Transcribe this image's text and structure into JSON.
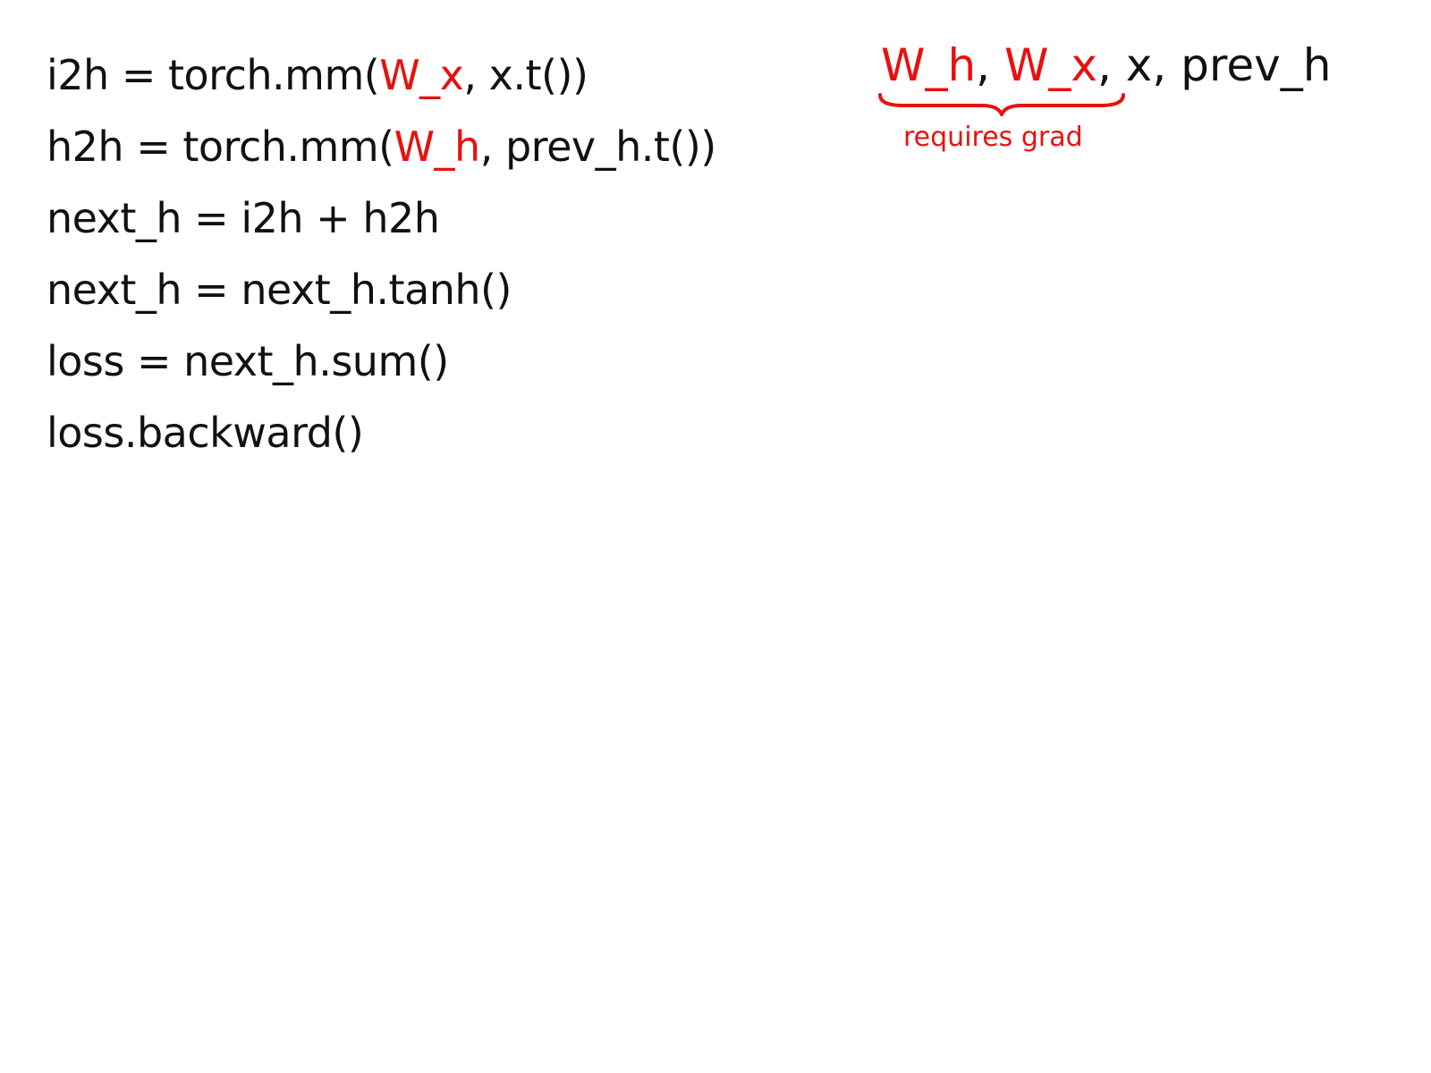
{
  "code_lines": [
    {
      "segments": [
        {
          "text": "i2h = torch.mm(",
          "color": "black"
        },
        {
          "text": "W_x",
          "color": "red"
        },
        {
          "text": ", x.t())",
          "color": "black"
        }
      ]
    },
    {
      "segments": [
        {
          "text": "h2h = torch.mm(",
          "color": "black"
        },
        {
          "text": "W_h",
          "color": "red"
        },
        {
          "text": ", prev_h.t())",
          "color": "black"
        }
      ]
    },
    {
      "segments": [
        {
          "text": "next_h = i2h + h2h",
          "color": "black"
        }
      ]
    },
    {
      "segments": [
        {
          "text": "next_h = next_h.tanh()",
          "color": "black"
        }
      ]
    },
    {
      "segments": [
        {
          "text": "loss = next_h.sum()",
          "color": "black"
        }
      ]
    },
    {
      "segments": [
        {
          "text": "loss.backward()",
          "color": "black"
        }
      ]
    }
  ],
  "variables": {
    "w_h": "W_h",
    "sep1": ", ",
    "w_x": "W_x",
    "sep2": ", ",
    "x": "x",
    "sep3": ", ",
    "prev_h": "prev_h"
  },
  "brace_label": "requires grad",
  "colors": {
    "ink": "#111111",
    "red": "#e8110f",
    "background": "#ffffff"
  }
}
